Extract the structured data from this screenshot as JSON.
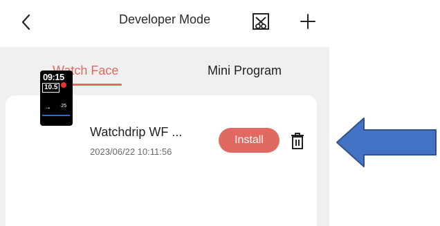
{
  "header": {
    "title": "Developer Mode",
    "back_icon": "chevron-left-icon",
    "scan_icon": "scan-icon",
    "add_icon": "plus-icon"
  },
  "tabs": [
    {
      "label": "Watch Face",
      "active": true
    },
    {
      "label": "Mini Program",
      "active": false
    }
  ],
  "watch_face": {
    "name": "Watchdrip WF ...",
    "date": "2023/06/22 10:11:56",
    "install_label": "Install",
    "delete_icon": "trash-icon",
    "thumbnail": {
      "time": "09:15",
      "glucose": "10.5",
      "trend": "→"
    }
  },
  "annotation": {
    "icon": "arrow-left-icon",
    "color": "#4472c4"
  },
  "colors": {
    "accent": "#e06a61",
    "background": "#f0f0f0",
    "card": "#ffffff"
  }
}
